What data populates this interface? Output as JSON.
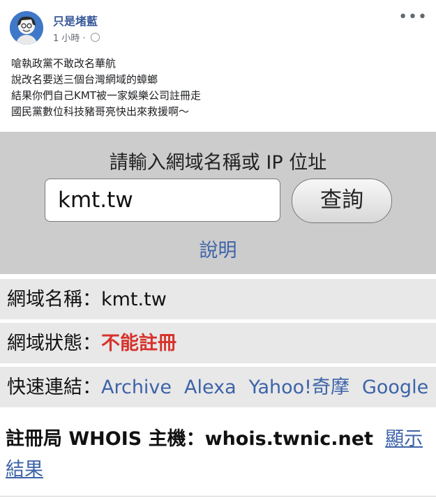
{
  "post": {
    "author": "只是堵藍",
    "time": "1 小時",
    "separator": " · ",
    "more": "•••",
    "lines": [
      "嗆執政黨不敢改名華航",
      "說改名要送三個台灣網域的蟑螂",
      "結果你們自己KMT被一家娛樂公司註冊走",
      "國民黨數位科技豬哥亮快出來救援啊～"
    ]
  },
  "query": {
    "title": "請輸入網域名稱或 IP 位址",
    "input_value": "kmt.tw",
    "button": "查詢",
    "help": "說明"
  },
  "result": {
    "domain_label": "網域名稱：",
    "domain_value": "kmt.tw",
    "status_label": "網域狀態：",
    "status_value": "不能註冊",
    "status_color": "#d6332c",
    "links_label": "快速連結：",
    "links": [
      "Archive",
      "Alexa",
      "Yahoo!奇摩",
      "Google"
    ],
    "whois_label": "註冊局 WHOIS 主機：",
    "whois_host": "whois.twnic.net",
    "whois_link": "顯示結果"
  }
}
